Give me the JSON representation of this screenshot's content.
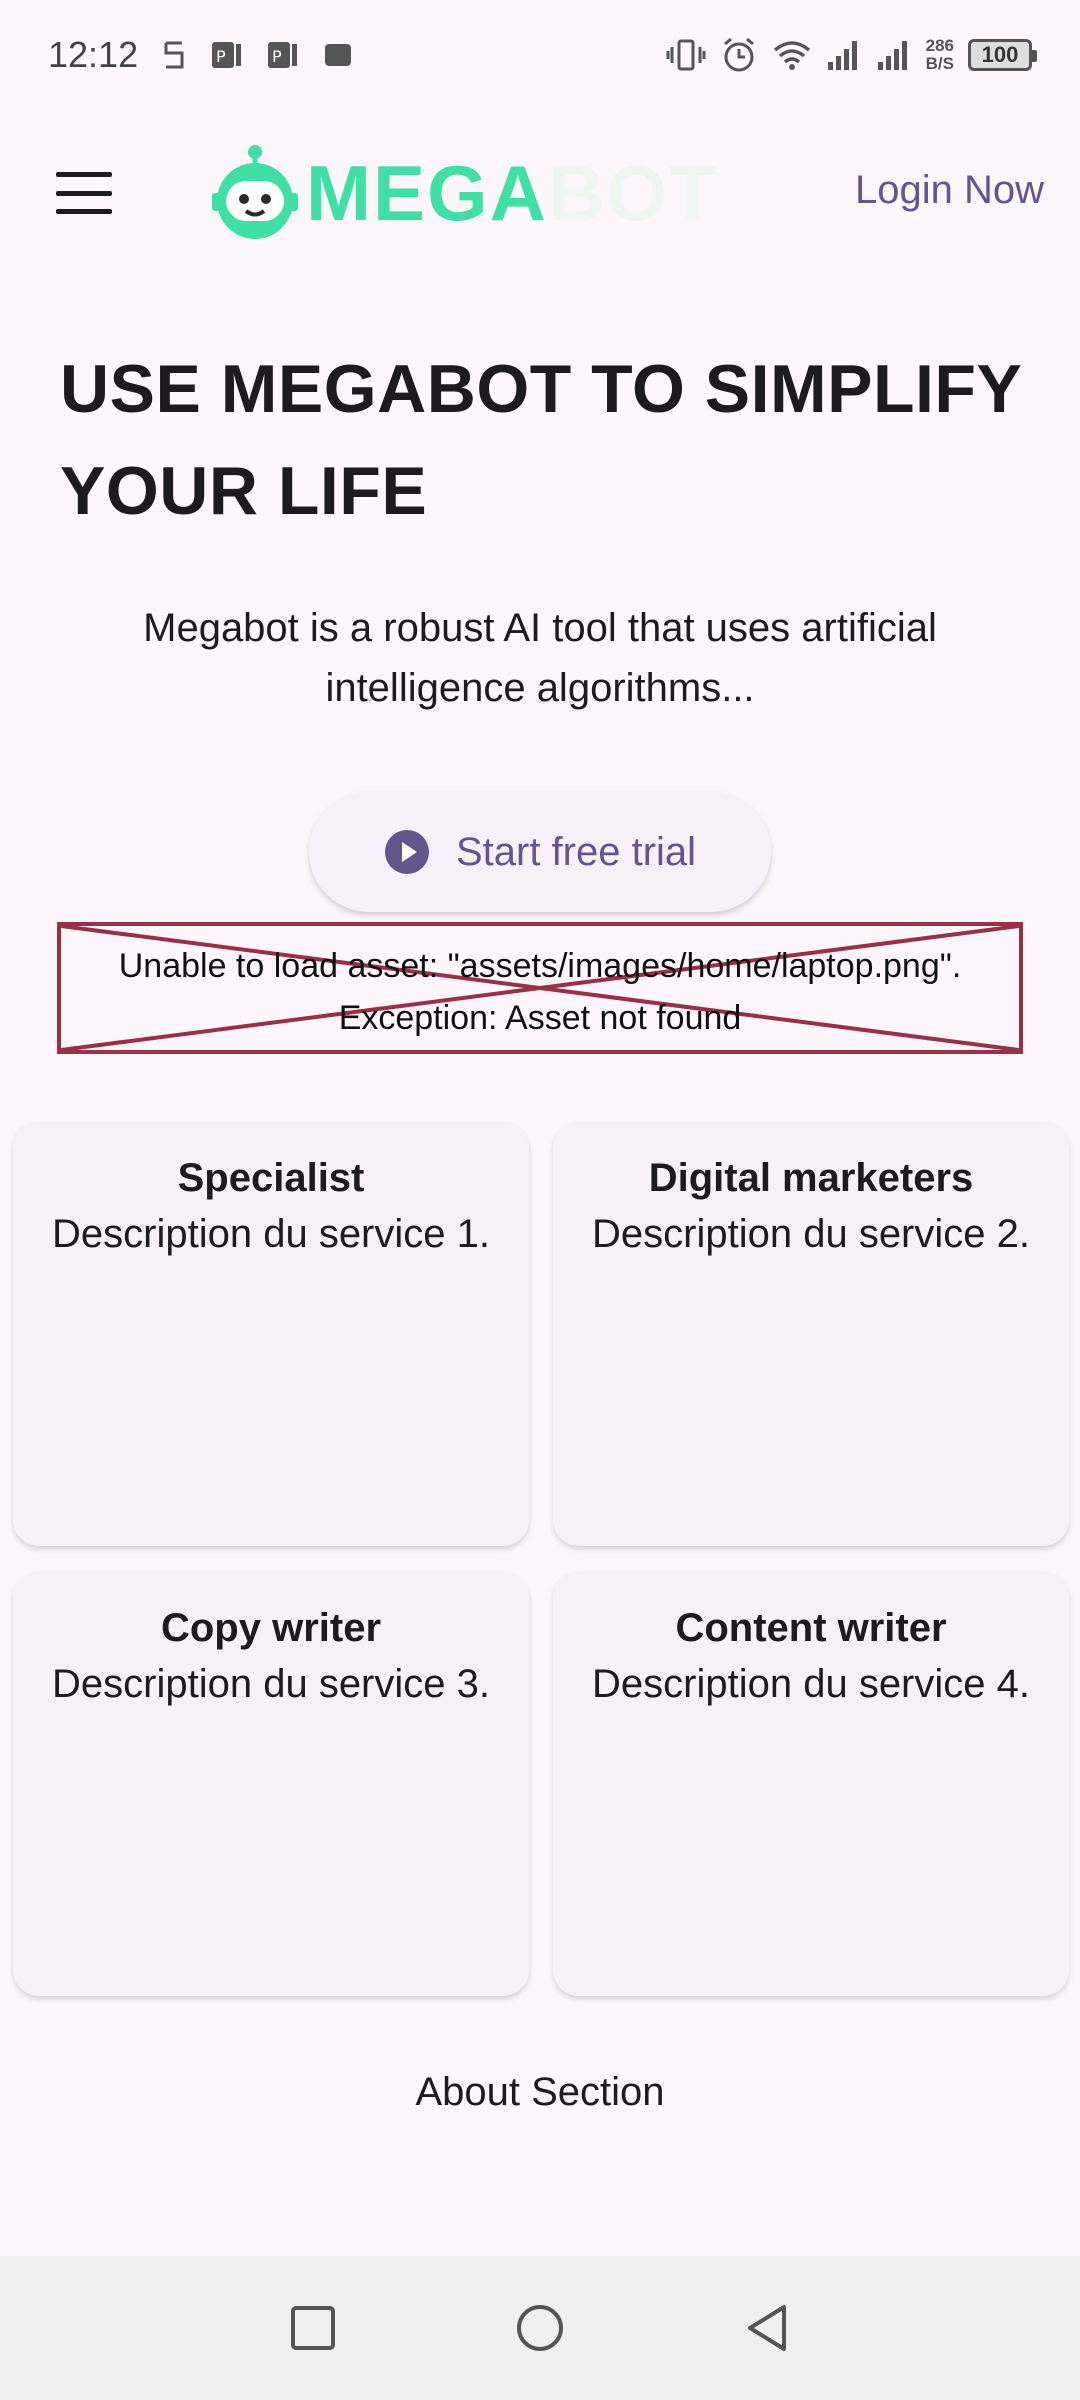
{
  "status_bar": {
    "time": "12:12",
    "net_speed_value": "286",
    "net_speed_unit": "B/S",
    "battery": "100"
  },
  "app_bar": {
    "logo_mega": "MEGA",
    "logo_bot": "BOT",
    "login_label": "Login Now"
  },
  "hero": {
    "title_line1": "USE MEGABOT TO SIMPLIFY",
    "title_line2": "YOUR LIFE",
    "description": "Megabot is a robust AI tool that uses artificial intelligence algorithms...",
    "cta_label": "Start free trial"
  },
  "error": {
    "line1": "Unable to load asset: \"assets/images/home/laptop.png\".",
    "line2": "Exception: Asset not found"
  },
  "services": [
    {
      "title": "Specialist",
      "description": "Description du service 1."
    },
    {
      "title": "Digital marketers",
      "description": "Description du service 2."
    },
    {
      "title": "Copy writer",
      "description": "Description du service 3."
    },
    {
      "title": "Content writer",
      "description": "Description du service 4."
    }
  ],
  "about": {
    "label": "About Section"
  },
  "colors": {
    "accent": "#65558f",
    "logo_green": "#3ee0a6",
    "error_border": "#9a2f48",
    "background": "#fdf7fc"
  }
}
